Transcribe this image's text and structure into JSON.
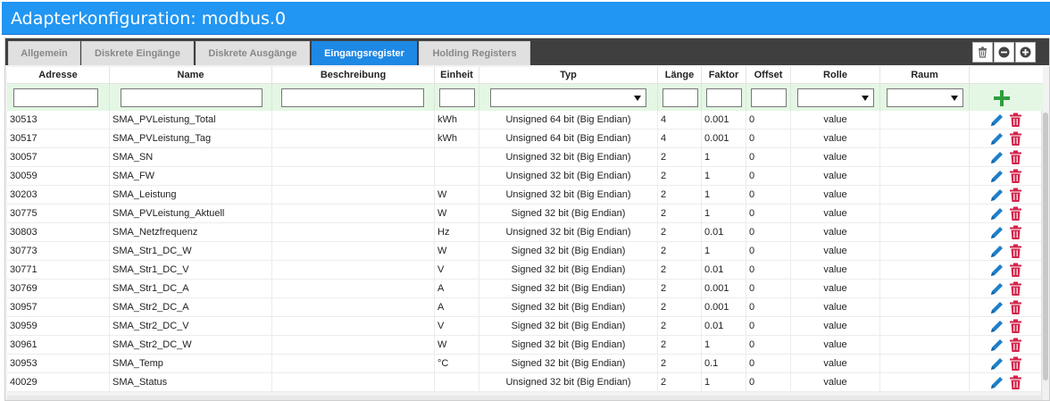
{
  "window": {
    "title": "Adapterkonfiguration: modbus.0"
  },
  "tabs": [
    {
      "label": "Allgemein",
      "active": false
    },
    {
      "label": "Diskrete Eingänge",
      "active": false
    },
    {
      "label": "Diskrete Ausgänge",
      "active": false
    },
    {
      "label": "Eingangsregister",
      "active": true
    },
    {
      "label": "Holding Registers",
      "active": false
    }
  ],
  "toolbar": {
    "icons": [
      "trash-icon",
      "minus-circle-icon",
      "plus-circle-icon"
    ]
  },
  "table": {
    "columns": [
      "Adresse",
      "Name",
      "Beschreibung",
      "Einheit",
      "Typ",
      "Länge",
      "Faktor",
      "Offset",
      "Rolle",
      "Raum"
    ],
    "filters": {
      "adresse": "",
      "name": "",
      "beschreibung": "",
      "einheit": "",
      "typ": "",
      "laenge": "",
      "faktor": "",
      "offset": "",
      "rolle": "",
      "raum": ""
    },
    "rows": [
      {
        "adresse": "30513",
        "name": "SMA_PVLeistung_Total",
        "beschreibung": "",
        "einheit": "kWh",
        "typ": "Unsigned 64 bit (Big Endian)",
        "laenge": "4",
        "faktor": "0.001",
        "offset": "0",
        "rolle": "value",
        "raum": ""
      },
      {
        "adresse": "30517",
        "name": "SMA_PVLeistung_Tag",
        "beschreibung": "",
        "einheit": "kWh",
        "typ": "Unsigned 64 bit (Big Endian)",
        "laenge": "4",
        "faktor": "0.001",
        "offset": "0",
        "rolle": "value",
        "raum": ""
      },
      {
        "adresse": "30057",
        "name": "SMA_SN",
        "beschreibung": "",
        "einheit": "",
        "typ": "Unsigned 32 bit (Big Endian)",
        "laenge": "2",
        "faktor": "1",
        "offset": "0",
        "rolle": "value",
        "raum": ""
      },
      {
        "adresse": "30059",
        "name": "SMA_FW",
        "beschreibung": "",
        "einheit": "",
        "typ": "Unsigned 32 bit (Big Endian)",
        "laenge": "2",
        "faktor": "1",
        "offset": "0",
        "rolle": "value",
        "raum": ""
      },
      {
        "adresse": "30203",
        "name": "SMA_Leistung",
        "beschreibung": "",
        "einheit": "W",
        "typ": "Unsigned 32 bit (Big Endian)",
        "laenge": "2",
        "faktor": "1",
        "offset": "0",
        "rolle": "value",
        "raum": ""
      },
      {
        "adresse": "30775",
        "name": "SMA_PVLeistung_Aktuell",
        "beschreibung": "",
        "einheit": "W",
        "typ": "Signed 32 bit (Big Endian)",
        "laenge": "2",
        "faktor": "1",
        "offset": "0",
        "rolle": "value",
        "raum": ""
      },
      {
        "adresse": "30803",
        "name": "SMA_Netzfrequenz",
        "beschreibung": "",
        "einheit": "Hz",
        "typ": "Unsigned 32 bit (Big Endian)",
        "laenge": "2",
        "faktor": "0.01",
        "offset": "0",
        "rolle": "value",
        "raum": ""
      },
      {
        "adresse": "30773",
        "name": "SMA_Str1_DC_W",
        "beschreibung": "",
        "einheit": "W",
        "typ": "Signed 32 bit (Big Endian)",
        "laenge": "2",
        "faktor": "1",
        "offset": "0",
        "rolle": "value",
        "raum": ""
      },
      {
        "adresse": "30771",
        "name": "SMA_Str1_DC_V",
        "beschreibung": "",
        "einheit": "V",
        "typ": "Signed 32 bit (Big Endian)",
        "laenge": "2",
        "faktor": "0.01",
        "offset": "0",
        "rolle": "value",
        "raum": ""
      },
      {
        "adresse": "30769",
        "name": "SMA_Str1_DC_A",
        "beschreibung": "",
        "einheit": "A",
        "typ": "Signed 32 bit (Big Endian)",
        "laenge": "2",
        "faktor": "0.001",
        "offset": "0",
        "rolle": "value",
        "raum": ""
      },
      {
        "adresse": "30957",
        "name": "SMA_Str2_DC_A",
        "beschreibung": "",
        "einheit": "A",
        "typ": "Signed 32 bit (Big Endian)",
        "laenge": "2",
        "faktor": "0.001",
        "offset": "0",
        "rolle": "value",
        "raum": ""
      },
      {
        "adresse": "30959",
        "name": "SMA_Str2_DC_V",
        "beschreibung": "",
        "einheit": "V",
        "typ": "Signed 32 bit (Big Endian)",
        "laenge": "2",
        "faktor": "0.01",
        "offset": "0",
        "rolle": "value",
        "raum": ""
      },
      {
        "adresse": "30961",
        "name": "SMA_Str2_DC_W",
        "beschreibung": "",
        "einheit": "W",
        "typ": "Signed 32 bit (Big Endian)",
        "laenge": "2",
        "faktor": "1",
        "offset": "0",
        "rolle": "value",
        "raum": ""
      },
      {
        "adresse": "30953",
        "name": "SMA_Temp",
        "beschreibung": "",
        "einheit": "°C",
        "typ": "Signed 32 bit (Big Endian)",
        "laenge": "2",
        "faktor": "0.1",
        "offset": "0",
        "rolle": "value",
        "raum": ""
      },
      {
        "adresse": "40029",
        "name": "SMA_Status",
        "beschreibung": "",
        "einheit": "",
        "typ": "Unsigned 32 bit (Big Endian)",
        "laenge": "2",
        "faktor": "1",
        "offset": "0",
        "rolle": "value",
        "raum": ""
      }
    ]
  },
  "row_actions": {
    "edit_icon": "pencil-icon",
    "delete_icon": "trash-icon"
  },
  "colors": {
    "title_bar": "#2196f3",
    "tab_active": "#1e88e5",
    "tab_bar": "#3f3f3f",
    "filter_row": "#e4f7e4",
    "add_icon": "#2e9e3e",
    "edit_icon": "#1e7fc8",
    "delete_icon": "#d2234a"
  }
}
